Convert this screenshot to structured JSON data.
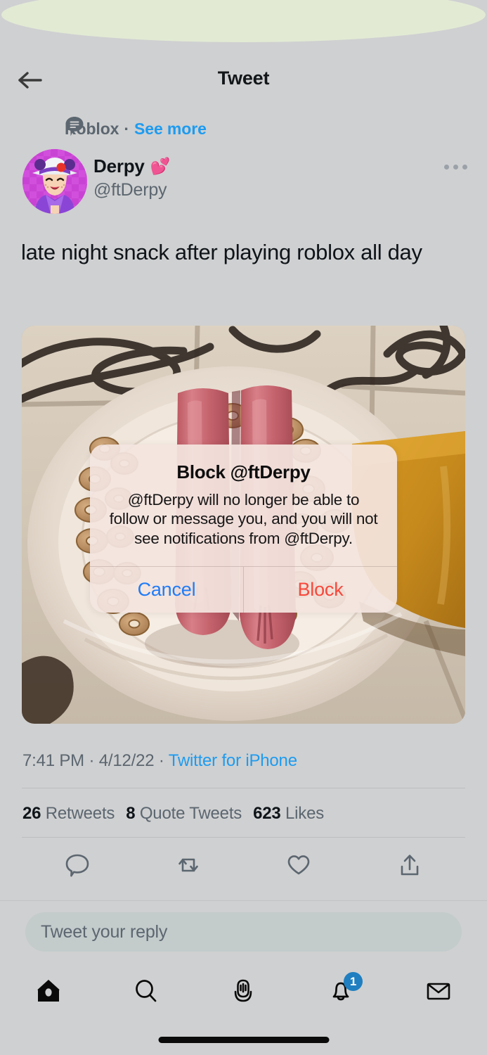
{
  "window": {
    "app_name": "Twitter",
    "platform": "iOS",
    "background_color": "#cfd0d1"
  },
  "header": {
    "back_icon": "arrow-left-icon",
    "title": "Tweet"
  },
  "topic": {
    "icon": "topic-bubble-icon",
    "name": "Roblox",
    "separator": "·",
    "see_more_label": "See more",
    "link_color": "#1d9bf0"
  },
  "author": {
    "avatar_icon": "avatar",
    "display_name": "Derpy",
    "name_emoji": "💕",
    "handle": "@ftDerpy",
    "overflow_icon": "more-options-icon"
  },
  "tweet": {
    "text": "late night snack after playing roblox all day",
    "media_alt": "photo-hot-dogs-and-cereal-on-plate"
  },
  "meta": {
    "time": "7:41 PM",
    "dot1": " · ",
    "date": "4/12/22",
    "dot2": " · ",
    "source": "Twitter for iPhone"
  },
  "stats": {
    "retweets_count": "26",
    "retweets_label": "Retweets",
    "quotes_count": "8",
    "quotes_label": "Quote Tweets",
    "likes_count": "623",
    "likes_label": "Likes"
  },
  "actions": [
    {
      "name": "reply-icon",
      "label": "Reply"
    },
    {
      "name": "retweet-icon",
      "label": "Retweet"
    },
    {
      "name": "like-icon",
      "label": "Like"
    },
    {
      "name": "share-icon",
      "label": "Share"
    }
  ],
  "composer": {
    "placeholder": "Tweet your reply"
  },
  "bottom_nav": [
    {
      "name": "home-icon",
      "label": "Home",
      "badge": null
    },
    {
      "name": "search-icon",
      "label": "Search",
      "badge": null
    },
    {
      "name": "spaces-mic-icon",
      "label": "Spaces",
      "badge": null
    },
    {
      "name": "notifications-bell-icon",
      "label": "Notifications",
      "badge": "1"
    },
    {
      "name": "messages-envelope-icon",
      "label": "Messages",
      "badge": null
    }
  ],
  "dialog": {
    "title": "Block @ftDerpy",
    "message": "@ftDerpy will no longer be able to follow or message you, and you will not see notifications from @ftDerpy.",
    "cancel_label": "Cancel",
    "confirm_label": "Block",
    "cancel_color": "#1f7cf7",
    "confirm_color": "#f8483b"
  }
}
